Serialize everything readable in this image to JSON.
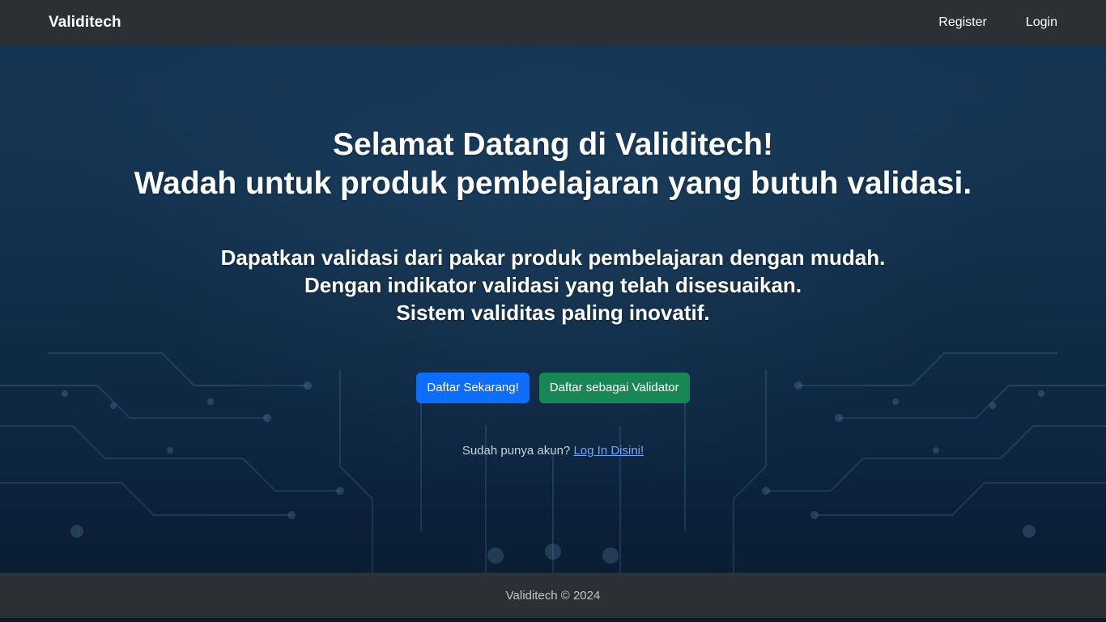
{
  "navbar": {
    "brand": "Validitech",
    "links": {
      "register": "Register",
      "login": "Login"
    }
  },
  "hero": {
    "title_line_1": "Selamat Datang di Validitech!",
    "title_line_2": "Wadah untuk produk pembelajaran yang butuh validasi.",
    "subtitle_lines": [
      "Dapatkan validasi dari pakar produk pembelajaran dengan mudah.",
      "Dengan indikator validasi yang telah disesuaikan.",
      "Sistem validitas paling inovatif."
    ],
    "buttons": {
      "register_now": "Daftar Sekarang!",
      "register_validator": "Daftar sebagai Validator"
    },
    "login_hint": {
      "text": "Sudah punya akun?",
      "link": "Log In Disini!"
    }
  },
  "footer": {
    "text": "Validitech © 2024"
  },
  "colors": {
    "navbar_bg": "#2b3035",
    "primary_button": "#0d6efd",
    "success_button": "#198754",
    "link": "#6ea8fe",
    "hero_bg": "#12304c"
  }
}
